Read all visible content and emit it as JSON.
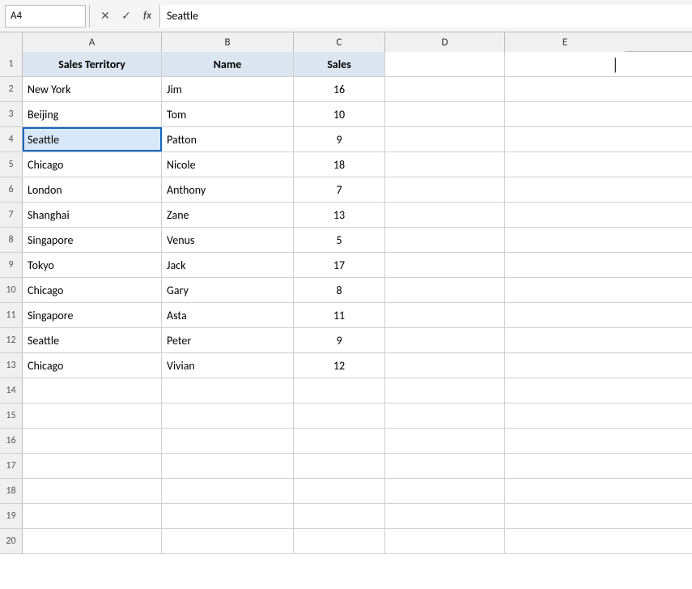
{
  "formulaBar": {
    "cellRef": "A4",
    "cancelLabel": "✕",
    "confirmLabel": "✓",
    "fxLabel": "fx",
    "formulaValue": "Seattle"
  },
  "columns": [
    {
      "id": "corner",
      "label": ""
    },
    {
      "id": "A",
      "label": "A"
    },
    {
      "id": "B",
      "label": "B"
    },
    {
      "id": "C",
      "label": "C"
    },
    {
      "id": "D",
      "label": "D"
    },
    {
      "id": "E",
      "label": "E"
    }
  ],
  "rows": [
    {
      "num": "1",
      "A": "Sales Territory",
      "B": "Name",
      "C": "Sales",
      "isHeader": true
    },
    {
      "num": "2",
      "A": "New York",
      "B": "Jim",
      "C": "16"
    },
    {
      "num": "3",
      "A": "Beijing",
      "B": "Tom",
      "C": "10"
    },
    {
      "num": "4",
      "A": "Seattle",
      "B": "Patton",
      "C": "9",
      "selected": true
    },
    {
      "num": "5",
      "A": "Chicago",
      "B": "Nicole",
      "C": "18"
    },
    {
      "num": "6",
      "A": "London",
      "B": "Anthony",
      "C": "7"
    },
    {
      "num": "7",
      "A": "Shanghai",
      "B": "Zane",
      "C": "13"
    },
    {
      "num": "8",
      "A": "Singapore",
      "B": "Venus",
      "C": "5"
    },
    {
      "num": "9",
      "A": "Tokyo",
      "B": "Jack",
      "C": "17"
    },
    {
      "num": "10",
      "A": "Chicago",
      "B": "Gary",
      "C": "8"
    },
    {
      "num": "11",
      "A": "Singapore",
      "B": "Asta",
      "C": "11"
    },
    {
      "num": "12",
      "A": "Seattle",
      "B": "Peter",
      "C": "9"
    },
    {
      "num": "13",
      "A": "Chicago",
      "B": "Vivian",
      "C": "12"
    },
    {
      "num": "14",
      "A": "",
      "B": "",
      "C": ""
    },
    {
      "num": "15",
      "A": "",
      "B": "",
      "C": ""
    },
    {
      "num": "16",
      "A": "",
      "B": "",
      "C": ""
    },
    {
      "num": "17",
      "A": "",
      "B": "",
      "C": ""
    },
    {
      "num": "18",
      "A": "",
      "B": "",
      "C": ""
    },
    {
      "num": "19",
      "A": "",
      "B": "",
      "C": ""
    },
    {
      "num": "20",
      "A": "",
      "B": "",
      "C": ""
    }
  ]
}
